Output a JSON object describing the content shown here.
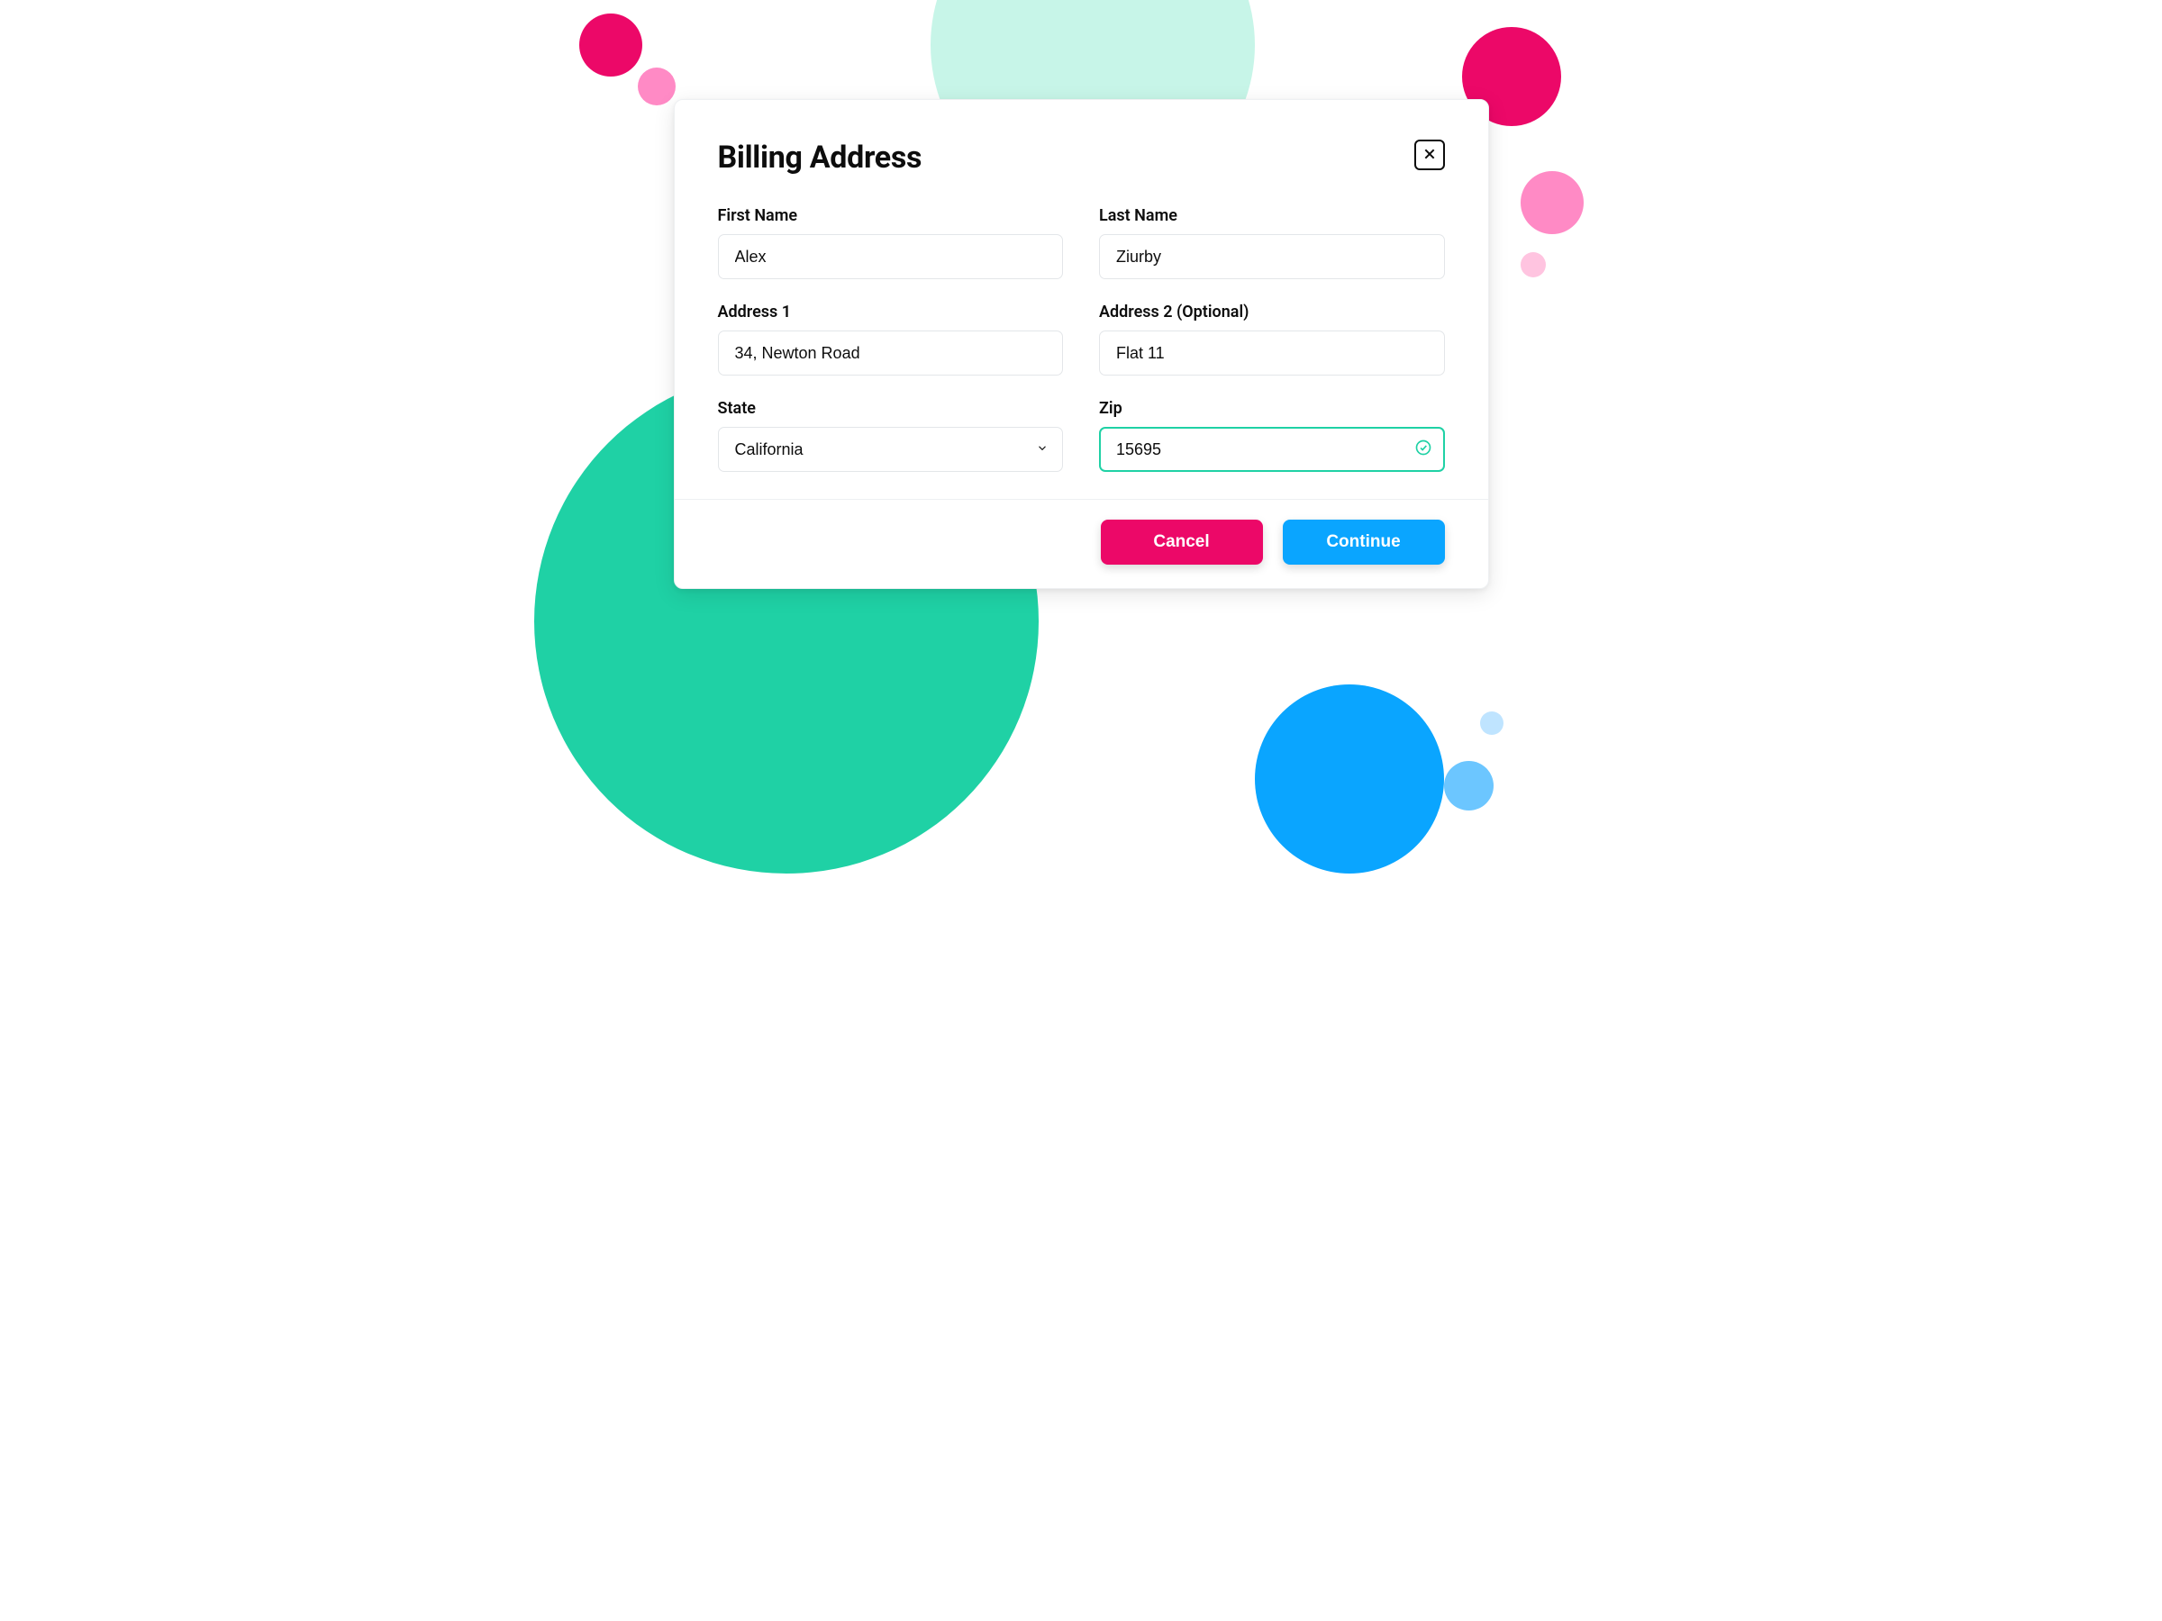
{
  "modal": {
    "title": "Billing Address",
    "fields": {
      "first_name": {
        "label": "First Name",
        "value": "Alex"
      },
      "last_name": {
        "label": "Last Name",
        "value": "Ziurby"
      },
      "address1": {
        "label": "Address 1",
        "value": "34, Newton Road"
      },
      "address2": {
        "label": "Address 2 (Optional)",
        "value": "Flat 11"
      },
      "state": {
        "label": "State",
        "value": "California"
      },
      "zip": {
        "label": "Zip",
        "value": "15695"
      }
    },
    "actions": {
      "cancel": "Cancel",
      "continue": "Continue"
    }
  },
  "colors": {
    "teal": "#1fd1a5",
    "magenta": "#ec0868",
    "blue": "#0aa5ff"
  }
}
